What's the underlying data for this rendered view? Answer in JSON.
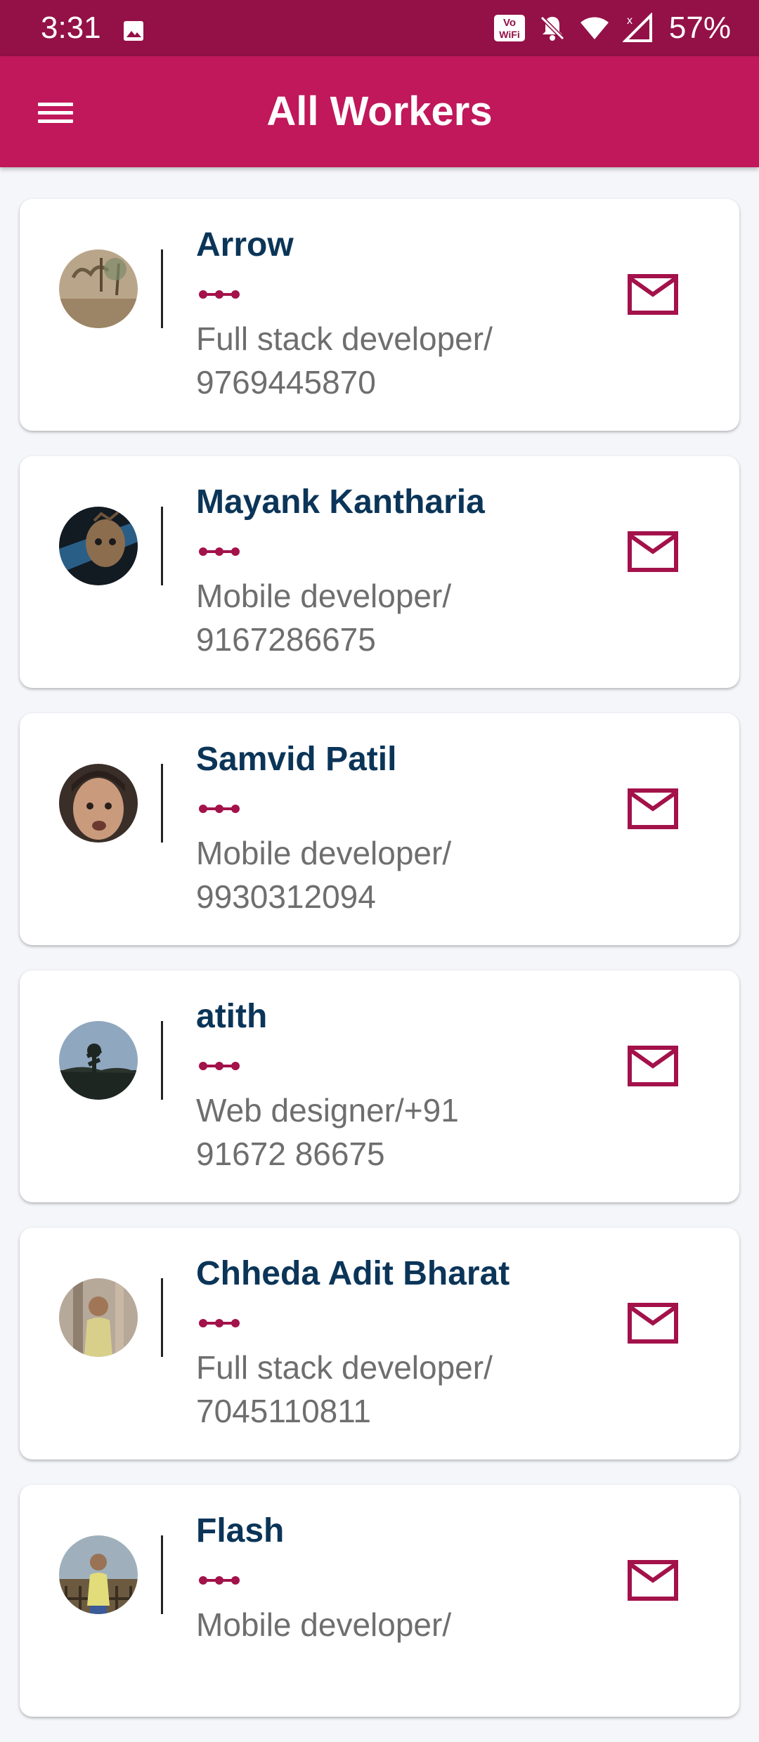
{
  "status_bar": {
    "time": "3:31",
    "battery": "57%",
    "icons": [
      "gallery-icon",
      "vowifi-icon",
      "bell-off-icon",
      "wifi-icon",
      "signal-icon"
    ]
  },
  "app_bar": {
    "title": "All Workers",
    "menu_icon": "hamburger-menu-icon",
    "color": "#c0185a",
    "status_color": "#931147"
  },
  "colors": {
    "name": "#0b3558",
    "accent": "#a3124a",
    "detail": "#6e6e6e"
  },
  "workers": [
    {
      "name": "Arrow",
      "detail_line1": "Full stack developer/",
      "detail_line2": "9769445870"
    },
    {
      "name": "Mayank Kantharia",
      "detail_line1": "Mobile developer/",
      "detail_line2": "9167286675"
    },
    {
      "name": "Samvid Patil",
      "detail_line1": "Mobile developer/",
      "detail_line2": "9930312094"
    },
    {
      "name": "atith",
      "detail_line1": "Web designer/+91",
      "detail_line2": "91672 86675"
    },
    {
      "name": "Chheda Adit Bharat",
      "detail_line1": "Full stack developer/",
      "detail_line2": "7045110811"
    },
    {
      "name": "Flash",
      "detail_line1": "Mobile developer/",
      "detail_line2": ""
    }
  ]
}
